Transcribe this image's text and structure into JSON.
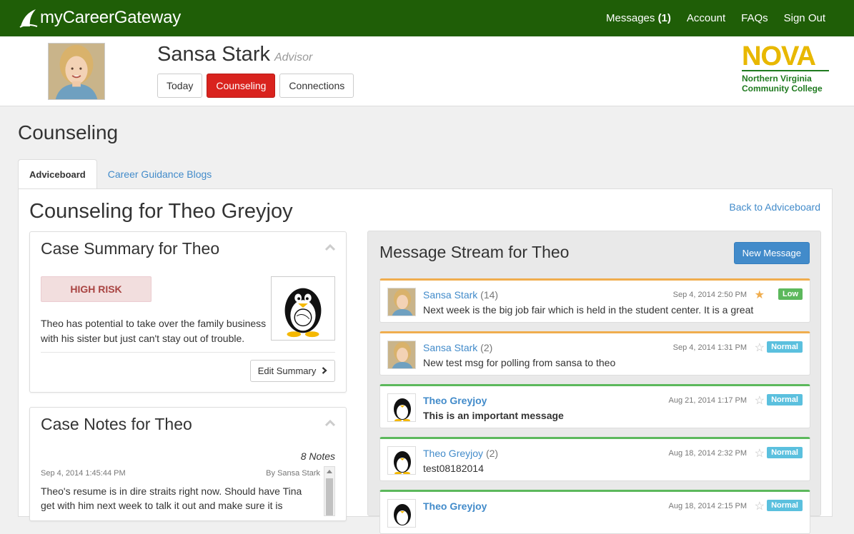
{
  "topbar": {
    "brand": "myCareerGateway",
    "nav": {
      "messages_label": "Messages",
      "messages_count": "(1)",
      "account": "Account",
      "faqs": "FAQs",
      "sign_out": "Sign Out"
    }
  },
  "profile": {
    "name": "Sansa Stark",
    "role": "Advisor",
    "tabs": [
      "Today",
      "Counseling",
      "Connections"
    ],
    "active_tab": "Counseling",
    "college_logo": {
      "big": "NOVA",
      "line1": "Northern Virginia",
      "line2": "Community College"
    }
  },
  "page": {
    "title": "Counseling",
    "tabs": [
      "Adviceboard",
      "Career Guidance Blogs"
    ],
    "active_tab": "Adviceboard",
    "subtitle": "Counseling for Theo Greyjoy",
    "back_link": "Back to Adviceboard"
  },
  "case_summary": {
    "title": "Case Summary for Theo",
    "risk": "HIGH RISK",
    "text": "Theo has potential to take over the family business with his sister but just can't stay out of trouble.",
    "edit_button": "Edit Summary"
  },
  "case_notes": {
    "title": "Case Notes for Theo",
    "count": "8 Notes",
    "note": {
      "date": "Sep 4, 2014 1:45:44 PM",
      "by": "By Sansa Stark",
      "text": "Theo's resume is in dire straits right now. Should have Tina get with him next week to talk it out and make sure it is"
    }
  },
  "stream": {
    "title": "Message Stream for Theo",
    "new_button": "New Message",
    "messages": [
      {
        "sender": "Sansa Stark",
        "count": "(14)",
        "date": "Sep 4, 2014 2:50 PM",
        "starred": true,
        "priority": "Low",
        "body": "Next week is the big job fair which is held in the student center. It is a great",
        "unread": false
      },
      {
        "sender": "Sansa Stark",
        "count": "(2)",
        "date": "Sep 4, 2014 1:31 PM",
        "starred": false,
        "priority": "Normal",
        "body": "New test msg for polling from sansa to theo",
        "unread": false
      },
      {
        "sender": "Theo Greyjoy",
        "count": "",
        "date": "Aug 21, 2014 1:17 PM",
        "starred": false,
        "priority": "Normal",
        "body": "This is an important message",
        "unread": true
      },
      {
        "sender": "Theo Greyjoy",
        "count": "(2)",
        "date": "Aug 18, 2014 2:32 PM",
        "starred": false,
        "priority": "Normal",
        "body": "test08182014",
        "unread": false
      },
      {
        "sender": "Theo Greyjoy",
        "count": "",
        "date": "Aug 18, 2014 2:15 PM",
        "starred": false,
        "priority": "Normal",
        "body": "",
        "unread": true
      }
    ]
  },
  "colors": {
    "topbar": "#1f5e07",
    "active_tab": "#d9231e",
    "link": "#428bca",
    "orange_border": "#f0ad4e",
    "green_border": "#5cb85c"
  }
}
